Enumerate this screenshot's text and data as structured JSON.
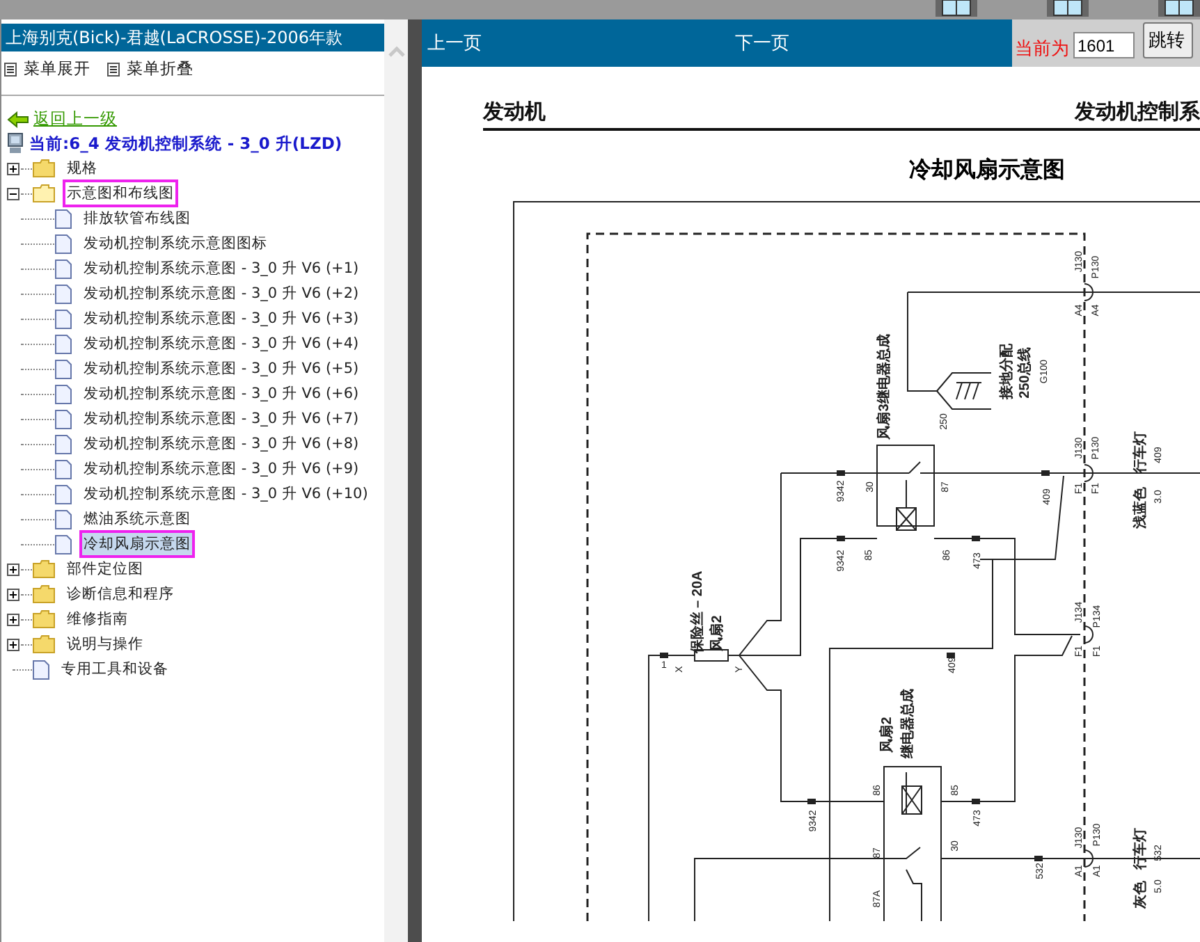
{
  "sidebar": {
    "title": "上海别克(Bick)-君越(LaCROSSE)-2006年款",
    "menu": [
      "菜单展开",
      "菜单折叠"
    ],
    "back_link": "返回上一级",
    "current": "当前:6_4 发动机控制系统 - 3_0 升(LZD)",
    "tree": [
      {
        "label": "规格",
        "kind": "folder",
        "expanded": false,
        "selected": false,
        "highlighted": false
      },
      {
        "label": "示意图和布线图",
        "kind": "folder",
        "expanded": true,
        "selected": false,
        "highlighted": true,
        "children": [
          {
            "label": "排放软管布线图",
            "kind": "doc",
            "selected": false,
            "highlighted": false
          },
          {
            "label": "发动机控制系统示意图图标",
            "kind": "doc",
            "selected": false,
            "highlighted": false
          },
          {
            "label": "发动机控制系统示意图 - 3_0 升 V6 (+1)",
            "kind": "doc",
            "selected": false,
            "highlighted": false
          },
          {
            "label": "发动机控制系统示意图 - 3_0 升 V6 (+2)",
            "kind": "doc",
            "selected": false,
            "highlighted": false
          },
          {
            "label": "发动机控制系统示意图 - 3_0 升 V6 (+3)",
            "kind": "doc",
            "selected": false,
            "highlighted": false
          },
          {
            "label": "发动机控制系统示意图 - 3_0 升 V6 (+4)",
            "kind": "doc",
            "selected": false,
            "highlighted": false
          },
          {
            "label": "发动机控制系统示意图 - 3_0 升 V6 (+5)",
            "kind": "doc",
            "selected": false,
            "highlighted": false
          },
          {
            "label": "发动机控制系统示意图 - 3_0 升 V6 (+6)",
            "kind": "doc",
            "selected": false,
            "highlighted": false
          },
          {
            "label": "发动机控制系统示意图 - 3_0 升 V6 (+7)",
            "kind": "doc",
            "selected": false,
            "highlighted": false
          },
          {
            "label": "发动机控制系统示意图 - 3_0 升 V6 (+8)",
            "kind": "doc",
            "selected": false,
            "highlighted": false
          },
          {
            "label": "发动机控制系统示意图 - 3_0 升 V6 (+9)",
            "kind": "doc",
            "selected": false,
            "highlighted": false
          },
          {
            "label": "发动机控制系统示意图 - 3_0 升 V6 (+10)",
            "kind": "doc",
            "selected": false,
            "highlighted": false
          },
          {
            "label": "燃油系统示意图",
            "kind": "doc",
            "selected": false,
            "highlighted": false
          },
          {
            "label": "冷却风扇示意图",
            "kind": "doc",
            "selected": true,
            "highlighted": true
          }
        ]
      },
      {
        "label": "部件定位图",
        "kind": "folder",
        "expanded": false,
        "selected": false,
        "highlighted": false
      },
      {
        "label": "诊断信息和程序",
        "kind": "folder",
        "expanded": false,
        "selected": false,
        "highlighted": false
      },
      {
        "label": "维修指南",
        "kind": "folder",
        "expanded": false,
        "selected": false,
        "highlighted": false
      },
      {
        "label": "说明与操作",
        "kind": "folder",
        "expanded": false,
        "selected": false,
        "highlighted": false
      },
      {
        "label": "专用工具和设备",
        "kind": "doc",
        "selected": false,
        "highlighted": false
      }
    ]
  },
  "navbar": {
    "prev": "上一页",
    "next": "下一页",
    "current_label": "当前为",
    "page_value": "1601",
    "go_button": "跳转"
  },
  "document": {
    "section": "发动机",
    "section_right": "发动机控制系",
    "title": "冷却风扇示意图",
    "labels": [
      "J130",
      "P130",
      "A4",
      "A4",
      "250",
      "接地分配",
      "250总线",
      "G100",
      "风扇3继电器总成",
      "30",
      "87",
      "9342",
      "409",
      "J130",
      "P130",
      "F1",
      "F1",
      "行车灯",
      "409",
      "浅蓝色",
      "3.0",
      "9342",
      "85",
      "86",
      "473",
      "保险丝 – 20A",
      "风扇2",
      "1",
      "X",
      "Y",
      "J134",
      "P134",
      "F1",
      "F1",
      "409",
      "风扇2",
      "继电器总成",
      "86",
      "85",
      "9342",
      "473",
      "87",
      "30",
      "532",
      "J130",
      "P130",
      "A1",
      "A1",
      "行车灯",
      "532",
      "灰色",
      "5.0",
      "87A"
    ]
  }
}
